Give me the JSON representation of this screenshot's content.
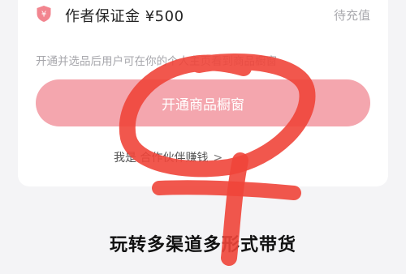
{
  "deposit": {
    "title": "作者保证金 ¥500",
    "status": "待充值",
    "icon": "shield-yen-icon"
  },
  "description": "开通并选品后用户可在你的个人主页看到商品橱窗",
  "open_button_label": "开通商品橱窗",
  "partner_link": {
    "label": "我是 合作伙伴赚钱",
    "chevron": ">"
  },
  "headline": "玩转多渠道多形式带货",
  "colors": {
    "button_bg": "#f4a6ae",
    "scribble": "#f0453a",
    "shield": "#f2858f"
  }
}
